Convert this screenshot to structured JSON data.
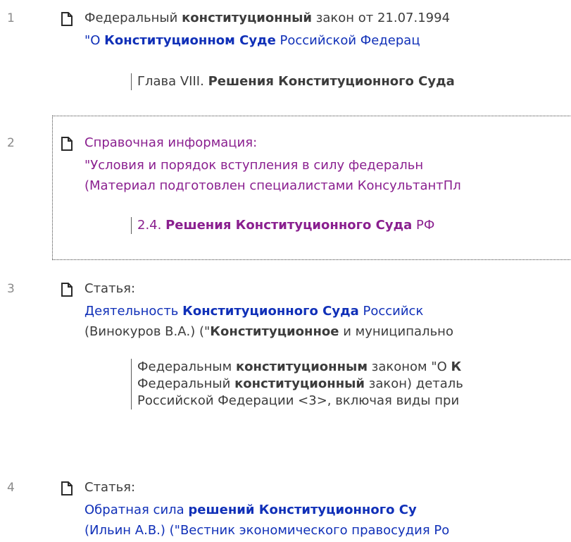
{
  "results": [
    {
      "number": "1",
      "title_lines": [
        [
          {
            "t": "Федеральный "
          },
          {
            "t": "конституционный",
            "b": true
          },
          {
            "t": " закон от 21.07.1994 "
          }
        ],
        [
          {
            "t": "\"О "
          },
          {
            "t": "Конституционном Суде",
            "b": true
          },
          {
            "t": " Российской Федерац"
          }
        ]
      ],
      "snippet": [
        [
          {
            "t": "Глава VIII. "
          },
          {
            "t": "Решения Конституционного Суда",
            "b": true
          }
        ]
      ]
    },
    {
      "number": "2",
      "title_lines": [
        [
          {
            "t": "Справочная информация:"
          }
        ],
        [
          {
            "t": "\"Условия и порядок вступления в силу федеральн"
          }
        ],
        [
          {
            "t": "(Материал подготовлен специалистами КонсультантПл"
          }
        ]
      ],
      "snippet": [
        [
          {
            "t": "2.4. "
          },
          {
            "t": "Решения Конституционного Суда",
            "b": true
          },
          {
            "t": " РФ"
          }
        ]
      ]
    },
    {
      "number": "3",
      "title_lines": [
        [
          {
            "t": "Статья:"
          }
        ],
        [
          {
            "t": "Деятельность "
          },
          {
            "t": "Конституционного Суда",
            "b": true
          },
          {
            "t": " Российск"
          }
        ],
        [
          {
            "t": "(Винокуров В.А.) (\""
          },
          {
            "t": "Конституционное",
            "b": true
          },
          {
            "t": " и муниципально"
          }
        ]
      ],
      "snippet": [
        [
          {
            "t": "Федеральным "
          },
          {
            "t": "конституционным",
            "b": true
          },
          {
            "t": " законом \"О "
          },
          {
            "t": "К",
            "b": true
          }
        ],
        [
          {
            "t": "Федеральный "
          },
          {
            "t": "конституционный",
            "b": true
          },
          {
            "t": " закон) деталь"
          }
        ],
        [
          {
            "t": "Российской Федерации <3>, включая виды при"
          }
        ]
      ]
    },
    {
      "number": "4",
      "title_lines": [
        [
          {
            "t": "Статья:"
          }
        ],
        [
          {
            "t": "Обратная сила "
          },
          {
            "t": "решений Конституционного Су",
            "b": true
          }
        ],
        [
          {
            "t": "(Ильин А.В.) (\"Вестник экономического правосудия Ро"
          }
        ]
      ],
      "snippet": []
    }
  ],
  "colors": {
    "link_blue": "#1030b8",
    "link_purple": "#8a1f8f",
    "text": "#3c3c3c",
    "number": "#8a8a8a"
  },
  "icon": "document-icon"
}
